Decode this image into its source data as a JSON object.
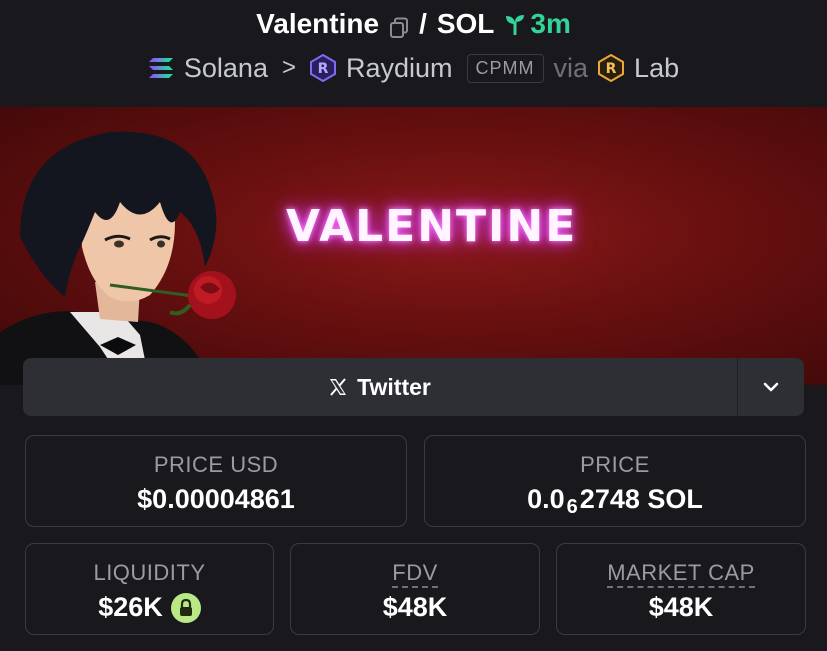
{
  "header": {
    "token_name": "Valentine",
    "separator": "/",
    "quote": "SOL",
    "age": "3m",
    "chain": "Solana",
    "chevron": ">",
    "dex": "Raydium",
    "pool_type": "CPMM",
    "via": "via",
    "launchpad": "Lab",
    "icons": {
      "copy": "copy-icon",
      "age": "seedling-icon",
      "chain": "solana-logo",
      "dex": "raydium-logo",
      "launchpad": "lab-logo"
    },
    "colors": {
      "age": "#34d399",
      "muted": "#9a9ba3"
    }
  },
  "banner": {
    "title": "VALENTINE"
  },
  "social": {
    "twitter_label": "Twitter",
    "twitter_icon": "x-logo",
    "more_icon": "chevron-down-icon"
  },
  "stats": {
    "price_usd": {
      "label": "PRICE USD",
      "value": "$0.00004861"
    },
    "price": {
      "label": "PRICE",
      "prefix": "0.0",
      "zeros": "6",
      "suffix": "2748 SOL"
    },
    "liquidity": {
      "label": "LIQUIDITY",
      "value": "$26K",
      "icon": "lock-icon"
    },
    "fdv": {
      "label": "FDV",
      "value": "$48K"
    },
    "market_cap": {
      "label": "MARKET CAP",
      "value": "$48K"
    }
  }
}
